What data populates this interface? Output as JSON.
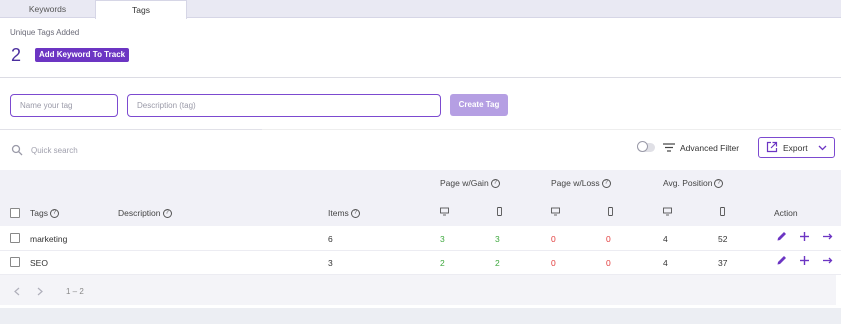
{
  "tabs": [
    {
      "label": "Keywords",
      "active": false
    },
    {
      "label": "Tags",
      "active": true
    }
  ],
  "summary": {
    "unique_label": "Unique Tags Added",
    "count": "2",
    "add_button": "Add Keyword To Track"
  },
  "form": {
    "name_placeholder": "Name your tag",
    "description_placeholder": "Description (tag)",
    "create_button": "Create Tag"
  },
  "toolbar": {
    "search_placeholder": "Quick search",
    "advanced_filter_label": "Advanced Filter",
    "advanced_filter_on": false,
    "export_label": "Export"
  },
  "table": {
    "group_headers": {
      "gain": "Page w/Gain",
      "loss": "Page w/Loss",
      "avg_position": "Avg. Position"
    },
    "columns": {
      "tags": "Tags",
      "description": "Description",
      "items": "Items",
      "action": "Action"
    },
    "rows": [
      {
        "tag": "marketing",
        "description": "",
        "items": "6",
        "gain_desktop": "3",
        "gain_mobile": "3",
        "loss_desktop": "0",
        "loss_mobile": "0",
        "pos_desktop": "4",
        "pos_mobile": "52"
      },
      {
        "tag": "SEO",
        "description": "",
        "items": "3",
        "gain_desktop": "2",
        "gain_mobile": "2",
        "loss_desktop": "0",
        "loss_mobile": "0",
        "pos_desktop": "4",
        "pos_mobile": "37"
      }
    ]
  },
  "pagination": {
    "range": "1 – 2"
  },
  "colors": {
    "accent": "#6c35c3",
    "gain": "#3ea83e",
    "loss": "#e23b3b"
  }
}
